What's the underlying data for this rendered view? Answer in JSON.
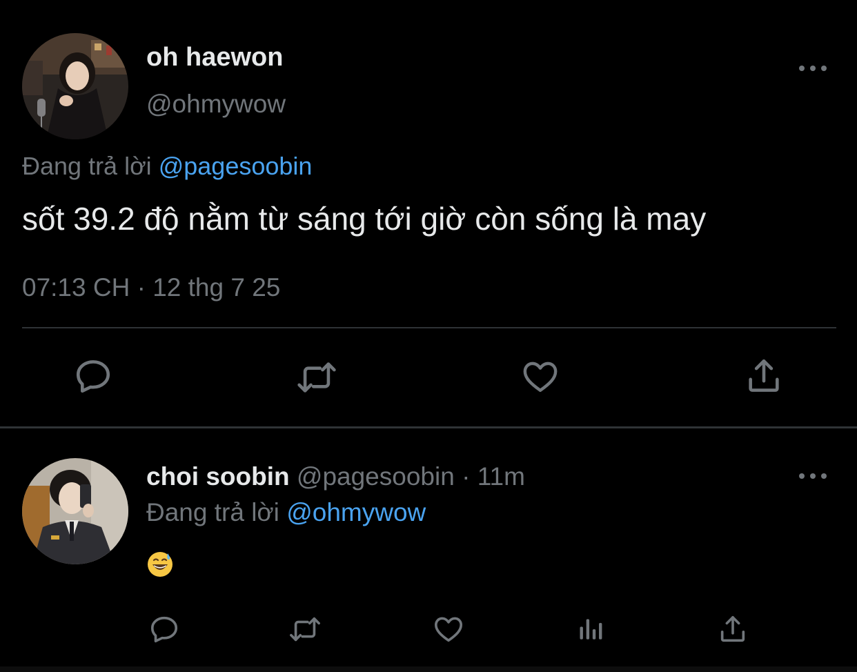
{
  "main_tweet": {
    "author_name": "oh haewon",
    "author_handle": "@ohmywow",
    "replying_prefix": "Đang trả lời",
    "replying_to": "@pagesoobin",
    "text": "sốt 39.2 độ nằm từ sáng tới giờ còn sống là may",
    "timestamp": "07:13 CH · 12 thg 7 25",
    "actions": [
      "reply-icon",
      "retweet-icon",
      "like-icon",
      "share-icon"
    ]
  },
  "reply_tweet": {
    "author_name": "choi soobin",
    "author_handle": "@pagesoobin",
    "separator": " · ",
    "time_ago": "11m",
    "replying_prefix": "Đang trả lời",
    "replying_to": "@ohmywow",
    "emoji": "grinning-face-with-sweat-emoji",
    "actions": [
      "reply-icon",
      "retweet-icon",
      "like-icon",
      "views-icon",
      "share-icon"
    ]
  },
  "colors": {
    "background": "#000000",
    "primary_text": "#e7e9ea",
    "secondary_text": "#71767b",
    "mention": "#4aa3f0",
    "divider": "#2f3336"
  }
}
